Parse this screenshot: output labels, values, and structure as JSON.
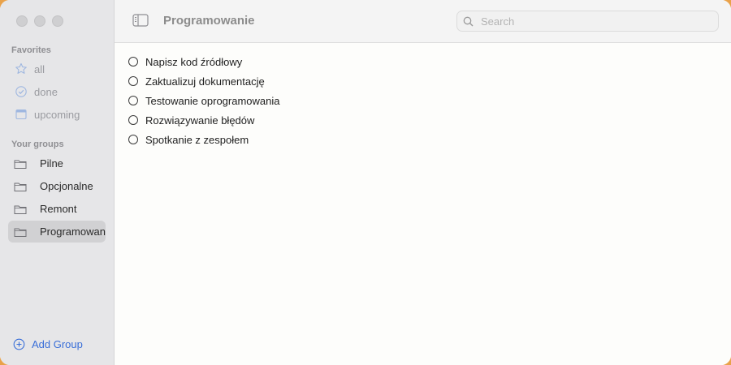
{
  "sidebar": {
    "favorites_title": "Favorites",
    "favorites": [
      {
        "label": "all",
        "icon": "star-icon"
      },
      {
        "label": "done",
        "icon": "checkmark-circle-icon"
      },
      {
        "label": "upcoming",
        "icon": "calendar-icon"
      }
    ],
    "groups_title": "Your groups",
    "groups": [
      {
        "label": "Pilne",
        "icon": "folder-icon"
      },
      {
        "label": "Opcjonalne",
        "icon": "folder-icon"
      },
      {
        "label": "Remont",
        "icon": "folder-icon"
      },
      {
        "label": "Programowanie",
        "icon": "folder-icon",
        "selected": true
      }
    ],
    "add_group_label": "Add Group"
  },
  "toolbar": {
    "title": "Programowanie",
    "search_placeholder": "Search"
  },
  "tasks": [
    {
      "label": "Napisz kod źródłowy",
      "done": false
    },
    {
      "label": "Zaktualizuj dokumentację",
      "done": false
    },
    {
      "label": "Testowanie oprogramowania",
      "done": false
    },
    {
      "label": "Rozwiązywanie błędów",
      "done": false
    },
    {
      "label": "Spotkanie z zespołem",
      "done": false
    }
  ],
  "colors": {
    "accent": "#3a6fd8",
    "sidebar_bg": "#e6e6e8",
    "selected_bg": "#d1d1d3"
  }
}
